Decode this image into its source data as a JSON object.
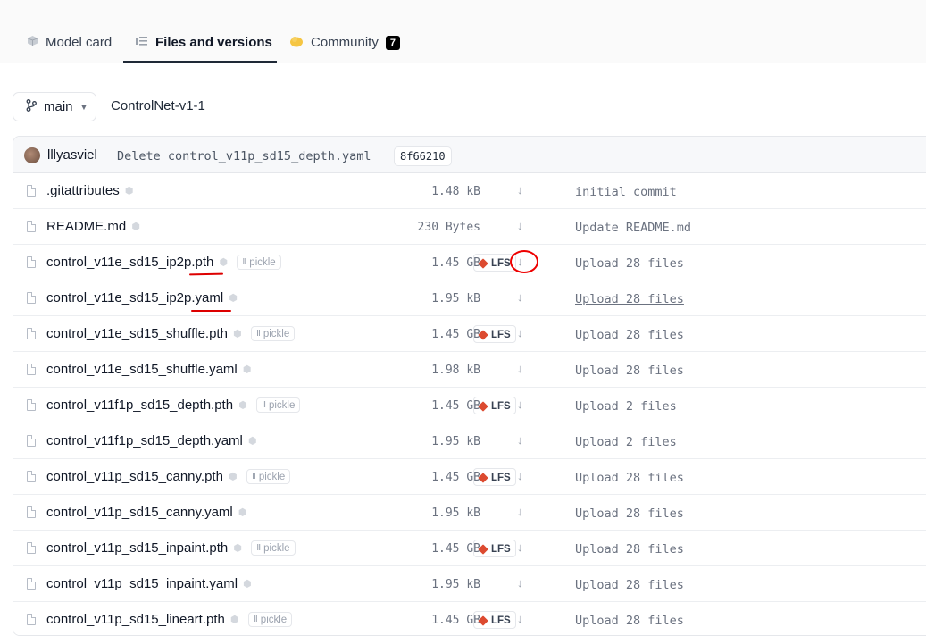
{
  "tabs": [
    {
      "label": "Model card",
      "icon": "cube-icon"
    },
    {
      "label": "Files and versions",
      "icon": "files-icon",
      "active": true
    },
    {
      "label": "Community",
      "icon": "community-icon",
      "count": "7"
    }
  ],
  "branch": {
    "label": "main",
    "icon": "branch-icon"
  },
  "repo_name": "ControlNet-v1-1",
  "last_commit": {
    "author": "lllyasviel",
    "message": "Delete control_v11p_sd15_depth.yaml",
    "hash": "8f66210"
  },
  "files": [
    {
      "name": ".gitattributes",
      "size": "1.48 kB",
      "commit": "initial commit"
    },
    {
      "name": "README.md",
      "size": "230 Bytes",
      "commit": "Update README.md"
    },
    {
      "name": "control_v11e_sd15_ip2p.pth",
      "size": "1.45 GB",
      "pickle": "pickle",
      "lfs": "LFS",
      "commit": "Upload 28 files"
    },
    {
      "name": "control_v11e_sd15_ip2p.yaml",
      "size": "1.95 kB",
      "commit": "Upload 28 files"
    },
    {
      "name": "control_v11e_sd15_shuffle.pth",
      "size": "1.45 GB",
      "pickle": "pickle",
      "lfs": "LFS",
      "commit": "Upload 28 files"
    },
    {
      "name": "control_v11e_sd15_shuffle.yaml",
      "size": "1.98 kB",
      "commit": "Upload 28 files"
    },
    {
      "name": "control_v11f1p_sd15_depth.pth",
      "size": "1.45 GB",
      "pickle": "pickle",
      "lfs": "LFS",
      "commit": "Upload 2 files"
    },
    {
      "name": "control_v11f1p_sd15_depth.yaml",
      "size": "1.95 kB",
      "commit": "Upload 2 files"
    },
    {
      "name": "control_v11p_sd15_canny.pth",
      "size": "1.45 GB",
      "pickle": "pickle",
      "lfs": "LFS",
      "commit": "Upload 28 files"
    },
    {
      "name": "control_v11p_sd15_canny.yaml",
      "size": "1.95 kB",
      "commit": "Upload 28 files"
    },
    {
      "name": "control_v11p_sd15_inpaint.pth",
      "size": "1.45 GB",
      "pickle": "pickle",
      "lfs": "LFS",
      "commit": "Upload 28 files"
    },
    {
      "name": "control_v11p_sd15_inpaint.yaml",
      "size": "1.95 kB",
      "commit": "Upload 28 files"
    },
    {
      "name": "control_v11p_sd15_lineart.pth",
      "size": "1.45 GB",
      "pickle": "pickle",
      "lfs": "LFS",
      "commit": "Upload 28 files"
    }
  ],
  "colors": {
    "accent": "#111827",
    "lfs": "#dc4a30",
    "annotation": "#dd0000"
  }
}
